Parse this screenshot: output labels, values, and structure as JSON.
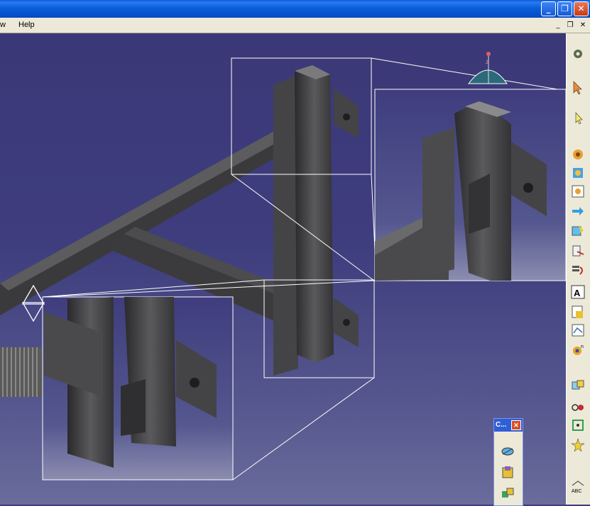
{
  "menu": {
    "partial_item": "w",
    "help": "Help"
  },
  "window_controls": {
    "minimize": "_",
    "restore": "❐",
    "close": "✕"
  },
  "doc_controls": {
    "minimize": "_",
    "restore": "❐",
    "close": "✕"
  },
  "toolbar_icons": [
    "gear-icon",
    "select-arrow-icon",
    "select-trap-icon",
    "assembly-gear-icon",
    "component-gear-icon",
    "existing-component-icon",
    "move-component-icon",
    "snap-icon",
    "manipulate-icon",
    "reorder-icon",
    "annotation-text-icon",
    "bill-of-material-icon",
    "scene-icon",
    "catalog-icon",
    "constraint-coincidence-icon",
    "constraint-contact-icon",
    "constraint-offset-icon",
    "constraint-angle-icon",
    "sketch-abc-icon"
  ],
  "palette": {
    "title": "C...",
    "close": "✕",
    "icons": [
      "measure-icon",
      "inertia-icon",
      "clash-icon"
    ]
  },
  "compass_label": "z"
}
